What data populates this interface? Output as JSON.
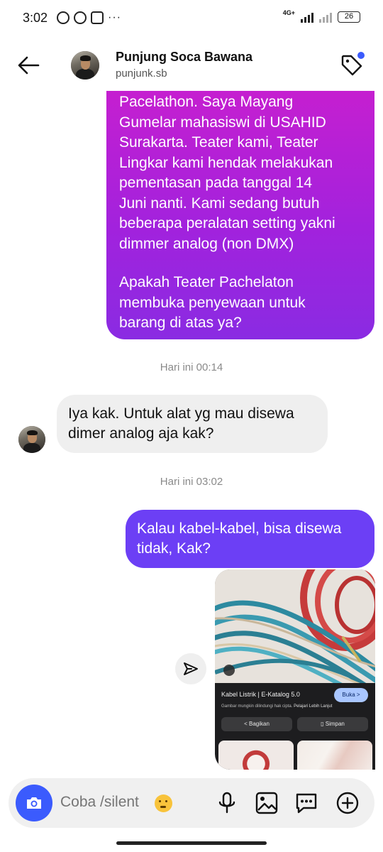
{
  "status_bar": {
    "time": "3:02",
    "network": "4G+",
    "battery": "26",
    "more": "···"
  },
  "header": {
    "name": "Punjung Soca Bawana",
    "username": "punjunk.sb",
    "tag_dot_color": "#3b5bfd"
  },
  "messages": {
    "outgoing_long": {
      "para1": "Pacelathon. Saya Mayang\nGumelar mahasiswi di USAHID\nSurakarta. Teater kami, Teater\nLingkar kami hendak melakukan\npementasan pada tanggal 14\nJuni nanti. Kami sedang butuh\nbeberapa peralatan setting yakni\ndimmer analog (non DMX)",
      "para2": "Apakah Teater Pachelaton\nmembuka penyewaan untuk\nbarang di atas ya?"
    },
    "timestamp_1": "Hari ini 00:14",
    "incoming": "Iya kak. Untuk alat yg mau disewa\ndimer analog aja kak?",
    "timestamp_2": "Hari ini 03:02",
    "outgoing_short": "Kalau kabel-kabel, bisa disewa\ntidak, Kak?"
  },
  "shared_card": {
    "title": "Kabel Listrik | E-Katalog 5.0",
    "open_label": "Buka >",
    "note": "Gambar mungkin dilindungi hak cipta.",
    "note_link": "Pelajari Lebih Lanjut",
    "share_label": "Bagikan",
    "save_label": "Simpan"
  },
  "composer": {
    "placeholder": "Coba /silent"
  },
  "colors": {
    "accent_blue": "#3b5bfd",
    "outgoing_gradient_top": "#c51fd0",
    "outgoing_gradient_bottom": "#8a2be2",
    "outgoing_small": "#6c3ff5",
    "incoming_bg": "#efefef"
  },
  "icons": [
    "back-arrow-icon",
    "tag-icon",
    "send-icon",
    "camera-icon",
    "microphone-icon",
    "gallery-icon",
    "sticker-icon",
    "plus-icon",
    "emoji-icon"
  ]
}
